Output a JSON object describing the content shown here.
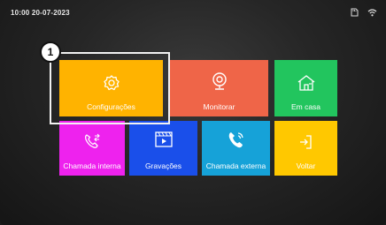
{
  "status_bar": {
    "datetime": "10:00 20-07-2023"
  },
  "tiles": [
    {
      "label": "Configurações",
      "icon": "gear-icon",
      "color": "#FFB300"
    },
    {
      "label": "Monitorar",
      "icon": "camera-icon",
      "color": "#EF6548"
    },
    {
      "label": "Em casa",
      "icon": "home-icon",
      "color": "#22C55E"
    },
    {
      "label": "Chamada interna",
      "icon": "intercom-call-icon",
      "color": "#EE22EE"
    },
    {
      "label": "Gravações",
      "icon": "recordings-icon",
      "color": "#1A4FEA"
    },
    {
      "label": "Chamada externa",
      "icon": "phone-call-icon",
      "color": "#16A2D8"
    },
    {
      "label": "Voltar",
      "icon": "exit-icon",
      "color": "#FFC800"
    }
  ],
  "callout": {
    "number": "1"
  }
}
